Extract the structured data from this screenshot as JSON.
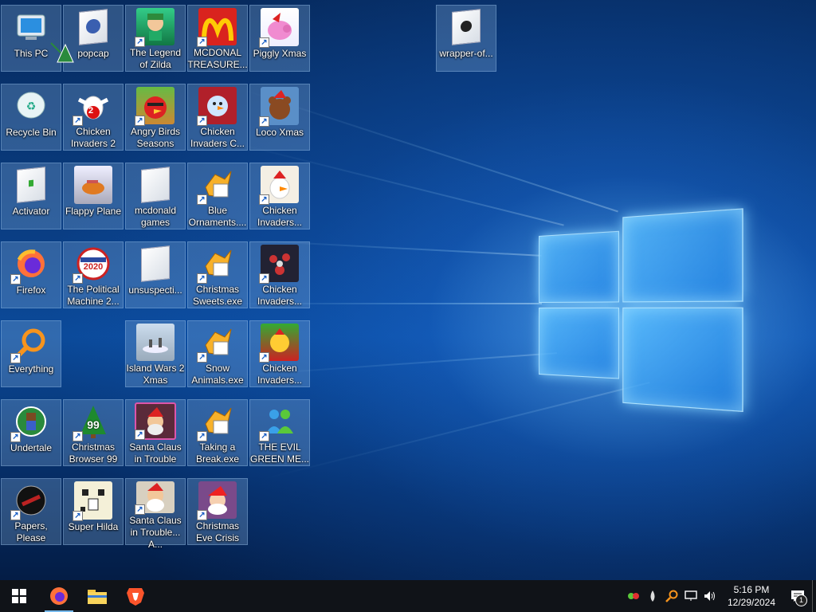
{
  "desktop": {
    "icons": [
      {
        "label": "This PC"
      },
      {
        "label": "popcap"
      },
      {
        "label": "The Legend of Zilda"
      },
      {
        "label": "MCDONAL TREASURE..."
      },
      {
        "label": "Piggly Xmas"
      },
      {
        "label": "wrapper-of..."
      },
      {
        "label": "Recycle Bin"
      },
      {
        "label": "Chicken Invaders 2"
      },
      {
        "label": "Angry Birds Seasons"
      },
      {
        "label": "Chicken Invaders C..."
      },
      {
        "label": "Loco Xmas"
      },
      {
        "label": "Activator"
      },
      {
        "label": "Flappy Plane"
      },
      {
        "label": "mcdonald games"
      },
      {
        "label": "Blue Ornaments...."
      },
      {
        "label": "Chicken Invaders..."
      },
      {
        "label": "Firefox"
      },
      {
        "label": "The Political Machine 2..."
      },
      {
        "label": "unsuspecti..."
      },
      {
        "label": "Christmas Sweets.exe"
      },
      {
        "label": "Chicken Invaders..."
      },
      {
        "label": "Everything"
      },
      {
        "label": "Island Wars 2 Xmas"
      },
      {
        "label": "Snow Animals.exe"
      },
      {
        "label": "Chicken Invaders..."
      },
      {
        "label": "Undertale"
      },
      {
        "label": "Christmas Browser 99"
      },
      {
        "label": "Santa Claus in Trouble"
      },
      {
        "label": "Taking a Break.exe"
      },
      {
        "label": "THE EVIL GREEN ME..."
      },
      {
        "label": "Papers, Please"
      },
      {
        "label": "Super Hilda"
      },
      {
        "label": "Santa Claus in Trouble... A..."
      },
      {
        "label": "Christmas Eve Crisis"
      }
    ]
  },
  "badges": {
    "political": "2020",
    "browser": "99",
    "ci2": "2"
  },
  "taskbar": {
    "items": [
      "windows-start",
      "firefox",
      "file-explorer",
      "brave"
    ],
    "time": "5:16 PM",
    "date": "12/29/2024",
    "notification_count": "1"
  }
}
